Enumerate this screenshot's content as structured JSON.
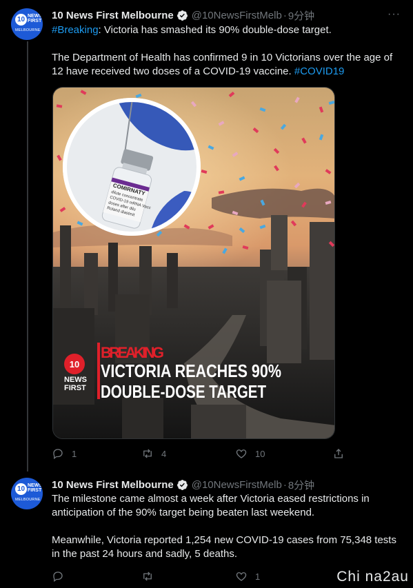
{
  "tweets": [
    {
      "display_name": "10 News First Melbourne",
      "handle": "@10NewsFirstMelb",
      "time": "9分钟",
      "hashtag_breaking": "#Breaking",
      "text_line1_rest": ": Victoria has smashed its 90% double-dose target.",
      "text_para2": "The Department of Health has confirmed 9 in 10 Victorians over the age of 12 have received two doses of a COVID-19 vaccine.",
      "hashtag_covid": "#COVID19",
      "media": {
        "kicker": "BREAKING",
        "headline_line1": "VICTORIA REACHES 90%",
        "headline_line2": "DOUBLE-DOSE TARGET",
        "logo_number": "10",
        "logo_text1": "NEWS",
        "logo_text2": "FIRST",
        "vial_label1": "COMIRNATY",
        "vial_label2": "dilute concentrate",
        "vial_label3": "COVID-19 mRNA Vacc",
        "vial_label4": "doses after dilu",
        "vial_label5": "Roland diastmit"
      },
      "replies": "1",
      "retweets": "4",
      "likes": "10"
    },
    {
      "display_name": "10 News First Melbourne",
      "handle": "@10NewsFirstMelb",
      "time": "8分钟",
      "text_para1": "The milestone came almost a week after Victoria eased restrictions in anticipation of the 90% target being beaten last weekend.",
      "text_para2": "Meanwhile, Victoria reported 1,254 new COVID-19 cases from 75,348 tests in the past 24 hours and sadly, 5 deaths.",
      "replies": "",
      "retweets": "",
      "likes": "1"
    }
  ],
  "avatar": {
    "number": "10",
    "line1": "NEWS",
    "line2": "FIRST",
    "line3": "MELBOURNE"
  },
  "watermark": "Chi na2au",
  "colors": {
    "background": "#000000",
    "link": "#1d9bf0",
    "muted": "#71767b",
    "verified": "#1d9bf0",
    "breaking_red": "#e0202a"
  }
}
